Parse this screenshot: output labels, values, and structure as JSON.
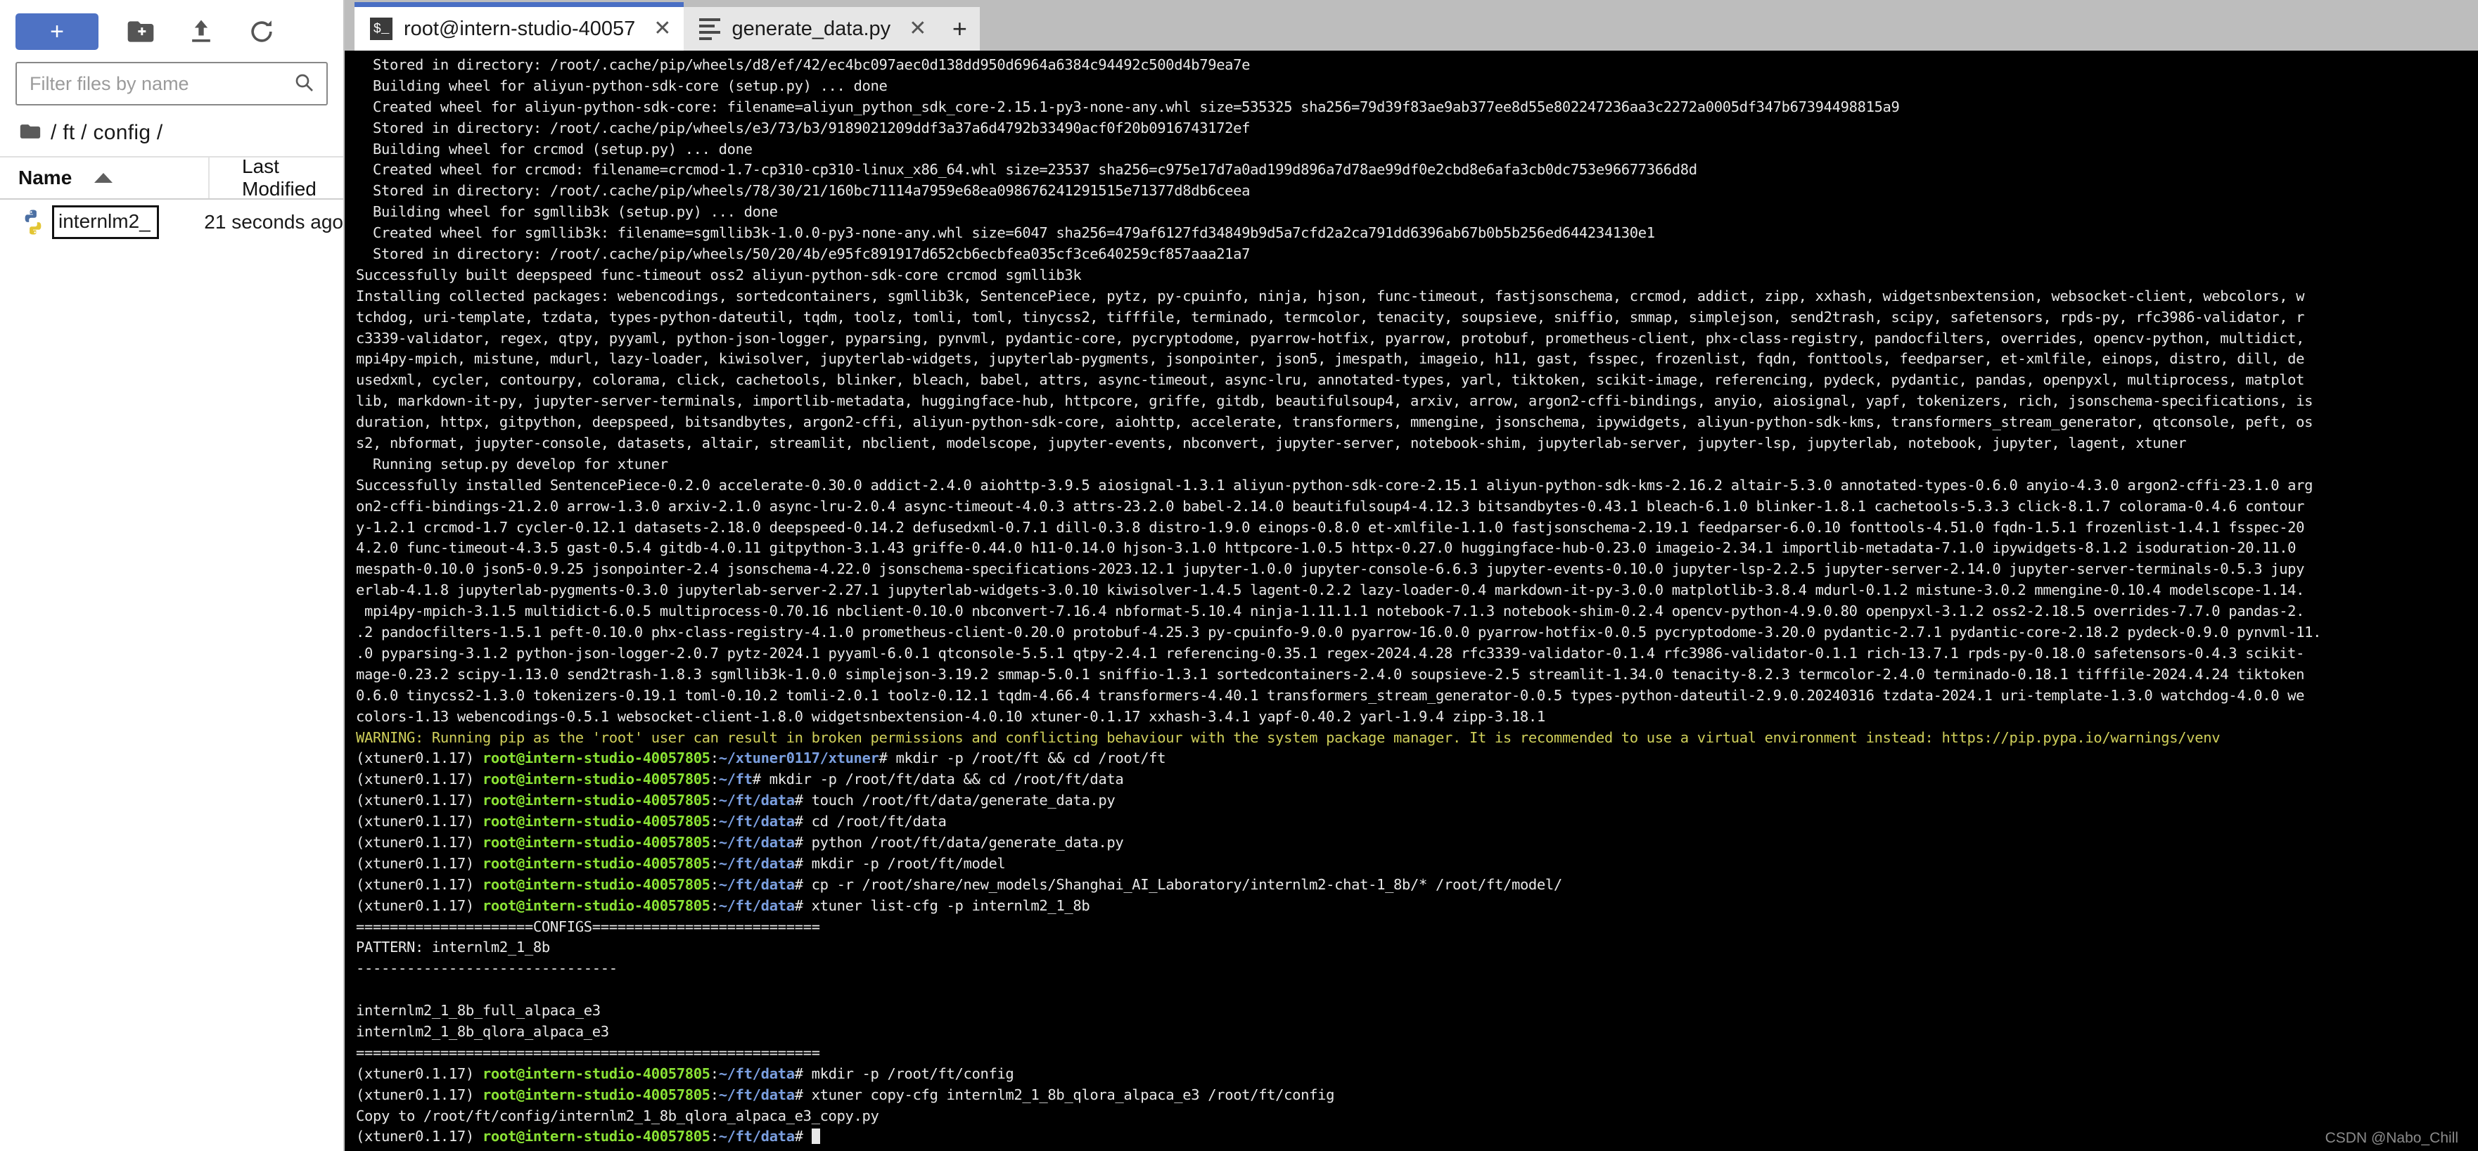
{
  "sidebar": {
    "toolbar": {
      "new_launcher_label": "+",
      "new_folder_icon": "new-folder-icon",
      "upload_icon": "upload-icon",
      "refresh_icon": "refresh-icon"
    },
    "filter": {
      "placeholder": "Filter files by name",
      "value": "",
      "search_icon": "search-icon"
    },
    "breadcrumb": {
      "folder_icon": "folder-icon",
      "path": "/ ft / config /"
    },
    "columns": {
      "name": "Name",
      "last_modified": "Last Modified",
      "sort_icon": "sort-ascending-icon"
    },
    "files": [
      {
        "icon": "python-file-icon",
        "name": "internlm2_ ...",
        "modified": "21 seconds ago",
        "editing": true
      }
    ]
  },
  "tabs": {
    "items": [
      {
        "label": "root@intern-studio-40057",
        "icon": "terminal-icon",
        "active": true,
        "close": "✕"
      },
      {
        "label": "generate_data.py",
        "icon": "python-editor-icon",
        "active": false,
        "close": "✕"
      }
    ],
    "new_tab_label": "+"
  },
  "terminal": {
    "prompt_env": "(xtuner0.1.17) ",
    "prompt_user": "root@intern-studio-40057805",
    "lines": [
      {
        "type": "plain",
        "text": "  Stored in directory: /root/.cache/pip/wheels/d8/ef/42/ec4bc097aec0d138dd950d6964a6384c94492c500d4b79ea7e"
      },
      {
        "type": "plain",
        "text": "  Building wheel for aliyun-python-sdk-core (setup.py) ... done"
      },
      {
        "type": "plain",
        "text": "  Created wheel for aliyun-python-sdk-core: filename=aliyun_python_sdk_core-2.15.1-py3-none-any.whl size=535325 sha256=79d39f83ae9ab377ee8d55e802247236aa3c2272a0005df347b67394498815a9"
      },
      {
        "type": "plain",
        "text": "  Stored in directory: /root/.cache/pip/wheels/e3/73/b3/9189021209ddf3a37a6d4792b33490acf0f20b0916743172ef"
      },
      {
        "type": "plain",
        "text": "  Building wheel for crcmod (setup.py) ... done"
      },
      {
        "type": "plain",
        "text": "  Created wheel for crcmod: filename=crcmod-1.7-cp310-cp310-linux_x86_64.whl size=23537 sha256=c975e17d7a0ad199d896a7d78ae99df0e2cbd8e6afa3cb0dc753e96677366d8d"
      },
      {
        "type": "plain",
        "text": "  Stored in directory: /root/.cache/pip/wheels/78/30/21/160bc71114a7959e68ea098676241291515e71377d8db6ceea"
      },
      {
        "type": "plain",
        "text": "  Building wheel for sgmllib3k (setup.py) ... done"
      },
      {
        "type": "plain",
        "text": "  Created wheel for sgmllib3k: filename=sgmllib3k-1.0.0-py3-none-any.whl size=6047 sha256=479af6127fd34849b9d5a7cfd2a2ca791dd6396ab67b0b5b256ed644234130e1"
      },
      {
        "type": "plain",
        "text": "  Stored in directory: /root/.cache/pip/wheels/50/20/4b/e95fc891917d652cb6ecbfea035cf3ce640259cf857aaa21a7"
      },
      {
        "type": "plain",
        "text": "Successfully built deepspeed func-timeout oss2 aliyun-python-sdk-core crcmod sgmllib3k"
      },
      {
        "type": "plain",
        "text": "Installing collected packages: webencodings, sortedcontainers, sgmllib3k, SentencePiece, pytz, py-cpuinfo, ninja, hjson, func-timeout, fastjsonschema, crcmod, addict, zipp, xxhash, widgetsnbextension, websocket-client, webcolors, w"
      },
      {
        "type": "plain",
        "text": "tchdog, uri-template, tzdata, types-python-dateutil, tqdm, toolz, tomli, toml, tinycss2, tifffile, terminado, termcolor, tenacity, soupsieve, sniffio, smmap, simplejson, send2trash, scipy, safetensors, rpds-py, rfc3986-validator, r"
      },
      {
        "type": "plain",
        "text": "c3339-validator, regex, qtpy, pyyaml, python-json-logger, pyparsing, pynvml, pydantic-core, pycryptodome, pyarrow-hotfix, pyarrow, protobuf, prometheus-client, phx-class-registry, pandocfilters, overrides, opencv-python, multidict,"
      },
      {
        "type": "plain",
        "text": "mpi4py-mpich, mistune, mdurl, lazy-loader, kiwisolver, jupyterlab-widgets, jupyterlab-pygments, jsonpointer, json5, jmespath, imageio, h11, gast, fsspec, frozenlist, fqdn, fonttools, feedparser, et-xmlfile, einops, distro, dill, de"
      },
      {
        "type": "plain",
        "text": "usedxml, cycler, contourpy, colorama, click, cachetools, blinker, bleach, babel, attrs, async-timeout, async-lru, annotated-types, yarl, tiktoken, scikit-image, referencing, pydeck, pydantic, pandas, openpyxl, multiprocess, matplot"
      },
      {
        "type": "plain",
        "text": "lib, markdown-it-py, jupyter-server-terminals, importlib-metadata, huggingface-hub, httpcore, griffe, gitdb, beautifulsoup4, arxiv, arrow, argon2-cffi-bindings, anyio, aiosignal, yapf, tokenizers, rich, jsonschema-specifications, is"
      },
      {
        "type": "plain",
        "text": "duration, httpx, gitpython, deepspeed, bitsandbytes, argon2-cffi, aliyun-python-sdk-core, aiohttp, accelerate, transformers, mmengine, jsonschema, ipywidgets, aliyun-python-sdk-kms, transformers_stream_generator, qtconsole, peft, os"
      },
      {
        "type": "plain",
        "text": "s2, nbformat, jupyter-console, datasets, altair, streamlit, nbclient, modelscope, jupyter-events, nbconvert, jupyter-server, notebook-shim, jupyterlab-server, jupyter-lsp, jupyterlab, notebook, jupyter, lagent, xtuner"
      },
      {
        "type": "plain",
        "text": "  Running setup.py develop for xtuner"
      },
      {
        "type": "plain",
        "text": "Successfully installed SentencePiece-0.2.0 accelerate-0.30.0 addict-2.4.0 aiohttp-3.9.5 aiosignal-1.3.1 aliyun-python-sdk-core-2.15.1 aliyun-python-sdk-kms-2.16.2 altair-5.3.0 annotated-types-0.6.0 anyio-4.3.0 argon2-cffi-23.1.0 arg"
      },
      {
        "type": "plain",
        "text": "on2-cffi-bindings-21.2.0 arrow-1.3.0 arxiv-2.1.0 async-lru-2.0.4 async-timeout-4.0.3 attrs-23.2.0 babel-2.14.0 beautifulsoup4-4.12.3 bitsandbytes-0.43.1 bleach-6.1.0 blinker-1.8.1 cachetools-5.3.3 click-8.1.7 colorama-0.4.6 contour"
      },
      {
        "type": "plain",
        "text": "y-1.2.1 crcmod-1.7 cycler-0.12.1 datasets-2.18.0 deepspeed-0.14.2 defusedxml-0.7.1 dill-0.3.8 distro-1.9.0 einops-0.8.0 et-xmlfile-1.1.0 fastjsonschema-2.19.1 feedparser-6.0.10 fonttools-4.51.0 fqdn-1.5.1 frozenlist-1.4.1 fsspec-20"
      },
      {
        "type": "plain",
        "text": "4.2.0 func-timeout-4.3.5 gast-0.5.4 gitdb-4.0.11 gitpython-3.1.43 griffe-0.44.0 h11-0.14.0 hjson-3.1.0 httpcore-1.0.5 httpx-0.27.0 huggingface-hub-0.23.0 imageio-2.34.1 importlib-metadata-7.1.0 ipywidgets-8.1.2 isoduration-20.11.0"
      },
      {
        "type": "plain",
        "text": "mespath-0.10.0 json5-0.9.25 jsonpointer-2.4 jsonschema-4.22.0 jsonschema-specifications-2023.12.1 jupyter-1.0.0 jupyter-console-6.6.3 jupyter-events-0.10.0 jupyter-lsp-2.2.5 jupyter-server-2.14.0 jupyter-server-terminals-0.5.3 jupy"
      },
      {
        "type": "plain",
        "text": "erlab-4.1.8 jupyterlab-pygments-0.3.0 jupyterlab-server-2.27.1 jupyterlab-widgets-3.0.10 kiwisolver-1.4.5 lagent-0.2.2 lazy-loader-0.4 markdown-it-py-3.0.0 matplotlib-3.8.4 mdurl-0.1.2 mistune-3.0.2 mmengine-0.10.4 modelscope-1.14."
      },
      {
        "type": "plain",
        "text": " mpi4py-mpich-3.1.5 multidict-6.0.5 multiprocess-0.70.16 nbclient-0.10.0 nbconvert-7.16.4 nbformat-5.10.4 ninja-1.11.1.1 notebook-7.1.3 notebook-shim-0.2.4 opencv-python-4.9.0.80 openpyxl-3.1.2 oss2-2.18.5 overrides-7.7.0 pandas-2."
      },
      {
        "type": "plain",
        "text": ".2 pandocfilters-1.5.1 peft-0.10.0 phx-class-registry-4.1.0 prometheus-client-0.20.0 protobuf-4.25.3 py-cpuinfo-9.0.0 pyarrow-16.0.0 pyarrow-hotfix-0.0.5 pycryptodome-3.20.0 pydantic-2.7.1 pydantic-core-2.18.2 pydeck-0.9.0 pynvml-11."
      },
      {
        "type": "plain",
        "text": ".0 pyparsing-3.1.2 python-json-logger-2.0.7 pytz-2024.1 pyyaml-6.0.1 qtconsole-5.5.1 qtpy-2.4.1 referencing-0.35.1 regex-2024.4.28 rfc3339-validator-0.1.4 rfc3986-validator-0.1.1 rich-13.7.1 rpds-py-0.18.0 safetensors-0.4.3 scikit-"
      },
      {
        "type": "plain",
        "text": "mage-0.23.2 scipy-1.13.0 send2trash-1.8.3 sgmllib3k-1.0.0 simplejson-3.19.2 smmap-5.0.1 sniffio-1.3.1 sortedcontainers-2.4.0 soupsieve-2.5 streamlit-1.34.0 tenacity-8.2.3 termcolor-2.4.0 terminado-0.18.1 tifffile-2024.4.24 tiktoken"
      },
      {
        "type": "plain",
        "text": "0.6.0 tinycss2-1.3.0 tokenizers-0.19.1 toml-0.10.2 tomli-2.0.1 toolz-0.12.1 tqdm-4.66.4 transformers-4.40.1 transformers_stream_generator-0.0.5 types-python-dateutil-2.9.0.20240316 tzdata-2024.1 uri-template-1.3.0 watchdog-4.0.0 we"
      },
      {
        "type": "plain",
        "text": "colors-1.13 webencodings-0.5.1 websocket-client-1.8.0 widgetsnbextension-4.0.10 xtuner-0.1.17 xxhash-3.4.1 yapf-0.40.2 yarl-1.9.4 zipp-3.18.1"
      },
      {
        "type": "warn",
        "text": "WARNING: Running pip as the 'root' user can result in broken permissions and conflicting behaviour with the system package manager. It is recommended to use a virtual environment instead: https://pip.pypa.io/warnings/venv"
      },
      {
        "type": "prompt",
        "cwd": "~/xtuner0117/xtuner",
        "cmd": "mkdir -p /root/ft && cd /root/ft"
      },
      {
        "type": "prompt",
        "cwd": "~/ft",
        "cmd": "mkdir -p /root/ft/data && cd /root/ft/data"
      },
      {
        "type": "prompt",
        "cwd": "~/ft/data",
        "cmd": "touch /root/ft/data/generate_data.py"
      },
      {
        "type": "prompt",
        "cwd": "~/ft/data",
        "cmd": "cd /root/ft/data"
      },
      {
        "type": "prompt",
        "cwd": "~/ft/data",
        "cmd": "python /root/ft/data/generate_data.py"
      },
      {
        "type": "prompt",
        "cwd": "~/ft/data",
        "cmd": "mkdir -p /root/ft/model"
      },
      {
        "type": "prompt",
        "cwd": "~/ft/data",
        "cmd": "cp -r /root/share/new_models/Shanghai_AI_Laboratory/internlm2-chat-1_8b/* /root/ft/model/"
      },
      {
        "type": "prompt",
        "cwd": "~/ft/data",
        "cmd": "xtuner list-cfg -p internlm2_1_8b"
      },
      {
        "type": "plain",
        "text": "=====================CONFIGS==========================="
      },
      {
        "type": "plain",
        "text": "PATTERN: internlm2_1_8b"
      },
      {
        "type": "plain",
        "text": "-------------------------------"
      },
      {
        "type": "plain",
        "text": ""
      },
      {
        "type": "plain",
        "text": "internlm2_1_8b_full_alpaca_e3"
      },
      {
        "type": "plain",
        "text": "internlm2_1_8b_qlora_alpaca_e3"
      },
      {
        "type": "plain",
        "text": "======================================================="
      },
      {
        "type": "prompt",
        "cwd": "~/ft/data",
        "cmd": "mkdir -p /root/ft/config"
      },
      {
        "type": "prompt",
        "cwd": "~/ft/data",
        "cmd": "xtuner copy-cfg internlm2_1_8b_qlora_alpaca_e3 /root/ft/config"
      },
      {
        "type": "plain",
        "text": "Copy to /root/ft/config/internlm2_1_8b_qlora_alpaca_e3_copy.py"
      },
      {
        "type": "prompt",
        "cwd": "~/ft/data",
        "cmd": "",
        "cursor": true
      }
    ]
  },
  "watermark": "CSDN @Nabo_Chill",
  "colors": {
    "accent": "#4e72c4",
    "tab_active_bar": "#4a6fc4",
    "terminal_bg": "#000000",
    "terminal_fg": "#e8e8e8",
    "prompt_user": "#8ae234",
    "prompt_path": "#7b9fe0",
    "warning": "#cfcf5a"
  }
}
